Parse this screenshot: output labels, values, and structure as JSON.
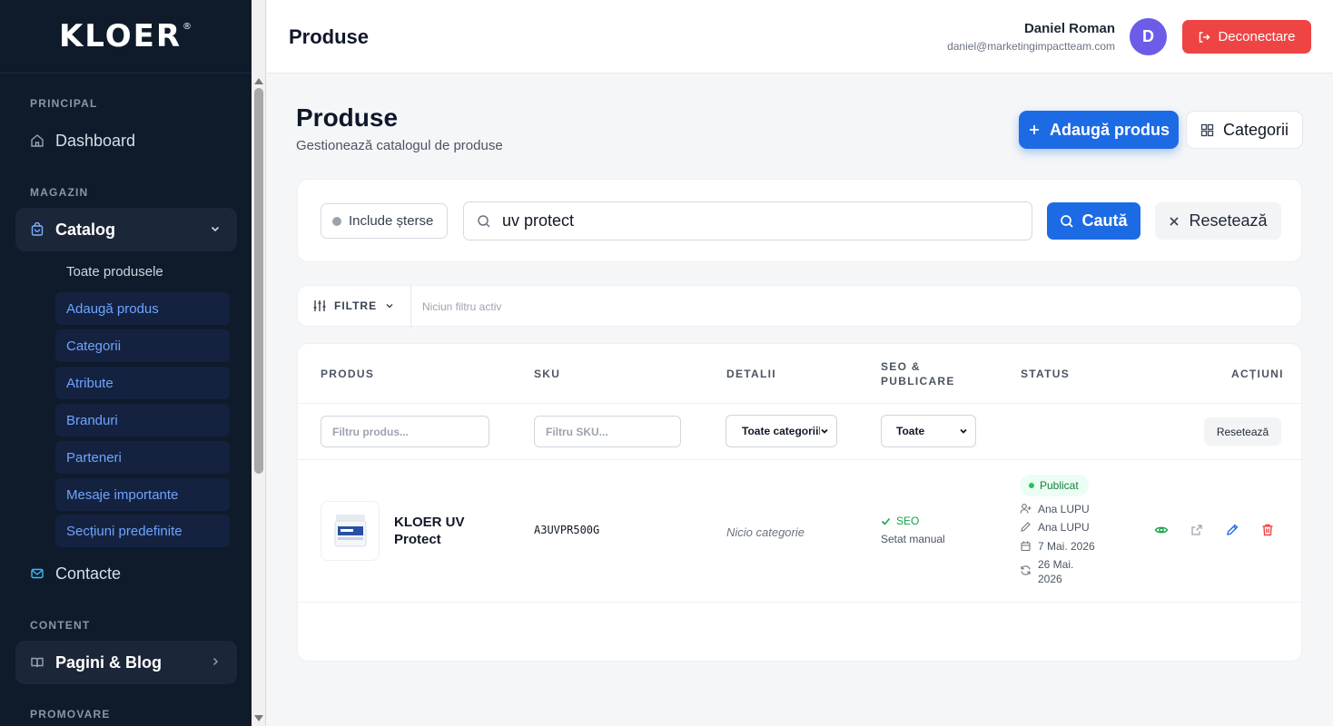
{
  "sidebar": {
    "logo": "KLOER",
    "sections": {
      "principal": "PRINCIPAL",
      "magazin": "MAGAZIN",
      "content": "CONTENT",
      "promovare": "PROMOVARE"
    },
    "items": {
      "dashboard": "Dashboard",
      "catalog": "Catalog",
      "contacte": "Contacte",
      "pagini_blog": "Pagini & Blog"
    },
    "catalog_sub": [
      "Toate produsele",
      "Adaugă produs",
      "Categorii",
      "Atribute",
      "Branduri",
      "Parteneri",
      "Mesaje importante",
      "Secțiuni predefinite"
    ]
  },
  "header": {
    "title": "Produse",
    "user_name": "Daniel Roman",
    "user_email": "daniel@marketingimpactteam.com",
    "avatar_initial": "D",
    "logout_label": "Deconectare"
  },
  "page": {
    "title": "Produse",
    "subtitle": "Gestionează catalogul de produse",
    "add_button": "Adaugă produs",
    "categories_button": "Categorii"
  },
  "search": {
    "include_deleted": "Include șterse",
    "query": "uv protect",
    "search_button": "Caută",
    "reset_button": "Resetează"
  },
  "filters": {
    "toggle_label": "FILTRE",
    "status": "Niciun filtru activ"
  },
  "table": {
    "headers": {
      "produs": "PRODUS",
      "sku": "SKU",
      "detalii": "DETALII",
      "seo_line1": "SEO &",
      "seo_line2": "PUBLICARE",
      "status": "STATUS",
      "actiuni": "ACȚIUNI"
    },
    "filter_row": {
      "product_placeholder": "Filtru produs...",
      "sku_placeholder": "Filtru SKU...",
      "category_select": "Toate categoriile",
      "seo_select": "Toate",
      "reset": "Resetează"
    },
    "rows": [
      {
        "name": "KLOER UV Protect",
        "sku": "A3UVPR500G",
        "details": "Nicio categorie",
        "seo": "SEO",
        "seo_note": "Setat manual",
        "status": "Publicat",
        "created_by": "Ana LUPU",
        "edited_by": "Ana LUPU",
        "created_date": "7 Mai. 2026",
        "updated_date_line1": "26 Mai.",
        "updated_date_line2": "2026"
      }
    ]
  },
  "colors": {
    "primary": "#1d6ae5",
    "danger": "#ef4444",
    "sidebar_bg": "#0f1a2b",
    "success": "#16a34a",
    "avatar": "#6d5ce8"
  }
}
